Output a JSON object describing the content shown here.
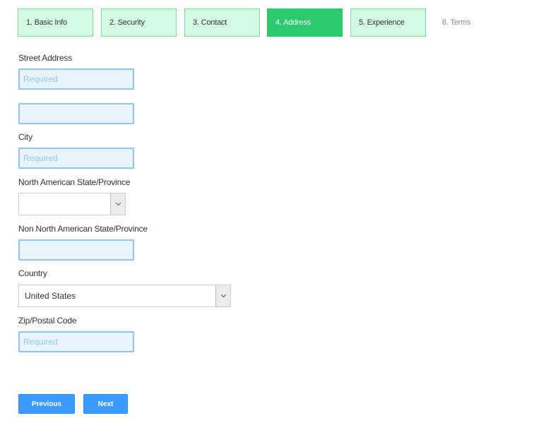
{
  "steps": [
    {
      "label": "1. Basic Info",
      "state": "completed"
    },
    {
      "label": "2. Security",
      "state": "completed"
    },
    {
      "label": "3. Contact",
      "state": "completed"
    },
    {
      "label": "4. Address",
      "state": "active"
    },
    {
      "label": "5. Experience",
      "state": "completed"
    },
    {
      "label": "6. Terms",
      "state": "upcoming"
    }
  ],
  "form": {
    "street_address": {
      "label": "Street Address",
      "line1": {
        "value": "",
        "placeholder": "Required"
      },
      "line2": {
        "value": "",
        "placeholder": ""
      }
    },
    "city": {
      "label": "City",
      "value": "",
      "placeholder": "Required"
    },
    "na_state": {
      "label": "North American State/Province",
      "selected": "",
      "icon": "chevron-down-icon"
    },
    "non_na_state": {
      "label": "Non North American State/Province",
      "value": "",
      "placeholder": ""
    },
    "country": {
      "label": "Country",
      "selected": "United States",
      "icon": "chevron-down-icon"
    },
    "zip": {
      "label": "Zip/Postal Code",
      "value": "",
      "placeholder": "Required"
    }
  },
  "buttons": {
    "previous": "Previous",
    "next": "Next"
  },
  "colors": {
    "step_completed_bg": "#d3fae2",
    "step_completed_border": "#7fe0a2",
    "step_active_bg": "#2ac96b",
    "input_bg": "#eaf4ff",
    "input_border": "#8ec6fb",
    "button_bg": "#3d9bff"
  }
}
